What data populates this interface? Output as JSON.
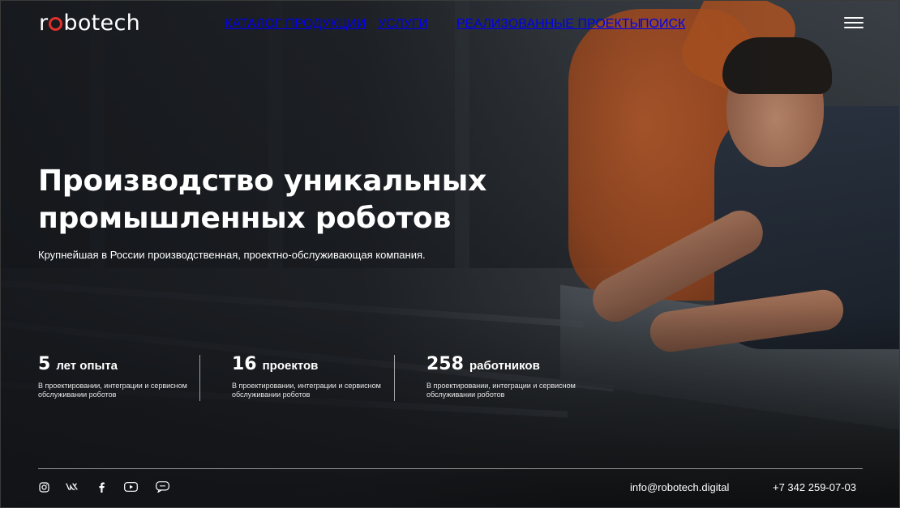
{
  "header": {
    "logo_text": "robotech",
    "nav": [
      {
        "label": "КАТАЛОГ ПРОДУКЦИИ"
      },
      {
        "label": "УСЛУГИ"
      },
      {
        "label": "РЕАЛИЗОВАННЫЕ ПРОЕКТЫ"
      },
      {
        "label": "ПОИСК"
      }
    ],
    "menu_icon": "hamburger-menu-icon"
  },
  "hero": {
    "title_line1": "Производство уникальных",
    "title_line2": "промышленных роботов",
    "subtitle": "Крупнейшая в России производственная, проектно-обслуживающая компания."
  },
  "stats": [
    {
      "number": "5",
      "unit": "лет опыта",
      "description": "В проектировании, интеграции и сервисном обслуживании роботов"
    },
    {
      "number": "16",
      "unit": "проектов",
      "description": "В проектировании, интеграции и сервисном обслуживании роботов"
    },
    {
      "number": "258",
      "unit": "работников",
      "description": "В проектировании, интеграции и сервисном обслуживании роботов"
    }
  ],
  "footer": {
    "socials": [
      "instagram-icon",
      "vk-icon",
      "facebook-icon",
      "youtube-icon",
      "chat-icon"
    ],
    "email": "info@robotech.digital",
    "phone": "+7 342 259-07-03"
  },
  "colors": {
    "accent": "#e2302c",
    "text": "#ffffff",
    "robot_orange": "#c25a22"
  }
}
